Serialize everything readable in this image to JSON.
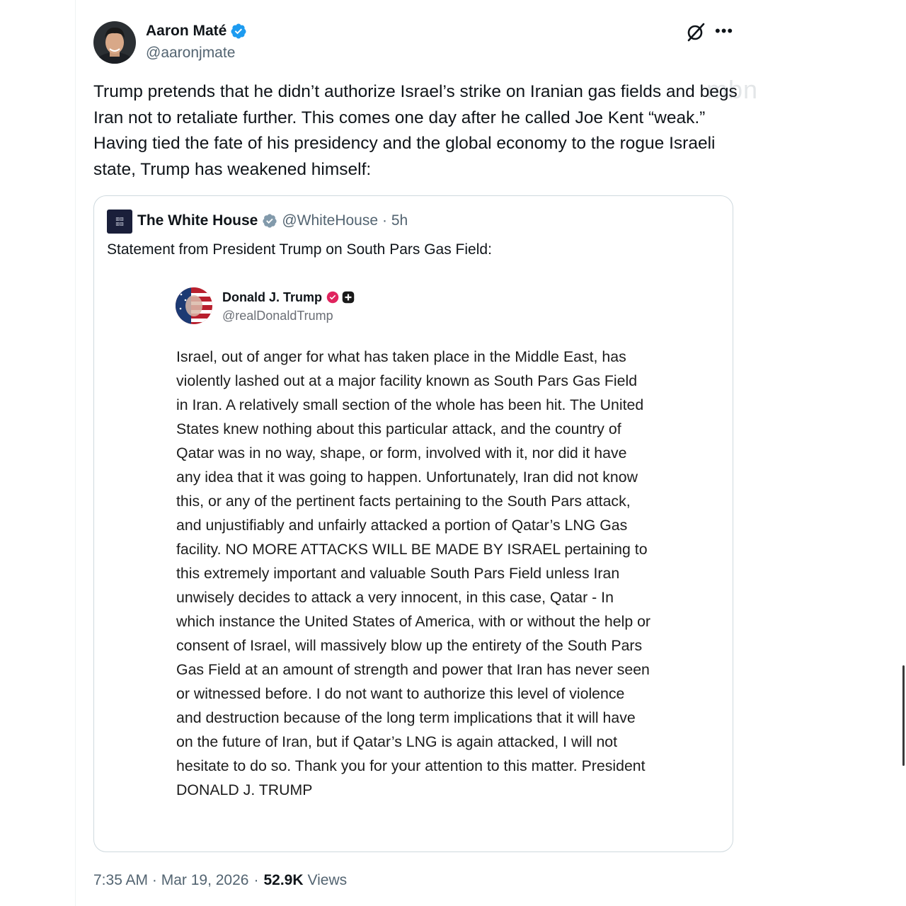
{
  "tweet": {
    "author": {
      "name": "Aaron Maté",
      "handle": "@aaronjmate"
    },
    "text": "Trump pretends that he didn’t authorize Israel’s strike on Iranian gas fields and begs Iran not to retaliate further. This comes one day after he called Joe Kent “weak.” Having tied the fate of his presidency and the global economy to the rogue Israeli state, Trump has weakened himself:",
    "watermark": "mbn",
    "timestamp": "7:35 AM · Mar 19, 2026",
    "separator": "·",
    "views_count": "52.9K",
    "views_label": "Views"
  },
  "quoted": {
    "name": "The White House",
    "handle": "@WhiteHouse",
    "time_meta": "· 5h",
    "text": "Statement from President Trump on South Pars Gas Field:",
    "embedded": {
      "name": "Donald J. Trump",
      "handle": "@realDonaldTrump",
      "text": "Israel, out of anger for what has taken place in the Middle East, has violently lashed out at a major facility known as South Pars Gas Field in Iran. A relatively small section of the whole has been hit. The United States knew nothing about this particular attack, and the country of Qatar was in no way, shape, or form, involved with it, nor did it have any idea that it was going to happen. Unfortunately, Iran did not know this, or any of the pertinent facts pertaining to the South Pars attack, and unjustifiably and unfairly attacked a portion of Qatar’s LNG Gas facility. NO MORE ATTACKS WILL BE MADE BY ISRAEL pertaining to this extremely important and valuable South Pars Field unless Iran unwisely decides to attack a very innocent, in this case, Qatar - In which instance the United States of America, with or without the help or consent of Israel, will massively blow up the entirety of the South Pars Gas Field at an amount of strength and power that Iran has never seen or witnessed before. I do not want to authorize this level of violence and destruction because of the long term implications that it will have on the future of Iran, but if Qatar’s LNG is again attacked, I will not hesitate to do so. Thank you for your attention to this matter. President DONALD J. TRUMP"
    }
  },
  "icons": [
    "verified-badge-icon",
    "grok-icon",
    "more-icon",
    "gray-verified-badge-icon",
    "pink-verified-badge-icon",
    "plus-badge-icon"
  ],
  "colors": {
    "verified_blue": "#1d9bf0",
    "gray_badge": "#829aab",
    "pink_badge": "#e0245e",
    "muted": "#536471"
  }
}
